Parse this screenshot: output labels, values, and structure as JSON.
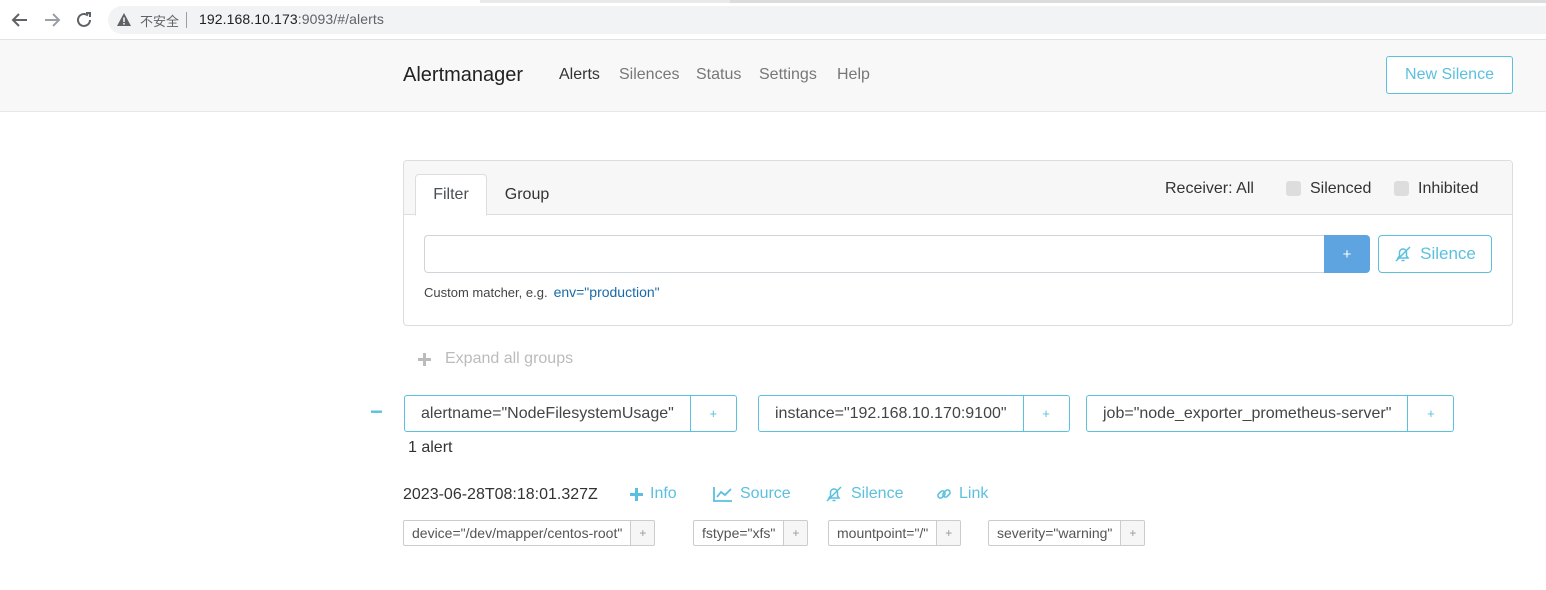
{
  "browser": {
    "insecure_label": "不安全",
    "url_host": "192.168.10.173",
    "url_rest": ":9093/#/alerts"
  },
  "navbar": {
    "brand": "Alertmanager",
    "items": [
      "Alerts",
      "Silences",
      "Status",
      "Settings",
      "Help"
    ],
    "active": "Alerts",
    "new_silence": "New Silence"
  },
  "filter": {
    "tabs": [
      "Filter",
      "Group"
    ],
    "receiver": "Receiver: All",
    "silenced_label": "Silenced",
    "inhibited_label": "Inhibited",
    "input_value": "",
    "add_label": "+",
    "silence_label": "Silence",
    "hint": "Custom matcher, e.g.",
    "hint_example": "env=\"production\""
  },
  "expand_all": "Expand all groups",
  "group": {
    "collapse": "−",
    "labels": [
      {
        "text": "alertname=\"NodeFilesystemUsage\"",
        "plus": "+"
      },
      {
        "text": "instance=\"192.168.10.170:9100\"",
        "plus": "+"
      },
      {
        "text": "job=\"node_exporter_prometheus-server\"",
        "plus": "+"
      }
    ],
    "count": "1 alert"
  },
  "alert": {
    "timestamp": "2023-06-28T08:18:01.327Z",
    "info": "Info",
    "source": "Source",
    "silence": "Silence",
    "link": "Link",
    "labels": [
      {
        "text": "device=\"/dev/mapper/centos-root\"",
        "plus": "+"
      },
      {
        "text": "fstype=\"xfs\"",
        "plus": "+"
      },
      {
        "text": "mountpoint=\"/\"",
        "plus": "+"
      },
      {
        "text": "severity=\"warning\"",
        "plus": "+"
      }
    ]
  },
  "colors": {
    "accent": "#5bc0de",
    "primary": "#5ea4e0",
    "navbar_bg": "#f8f8f8"
  }
}
